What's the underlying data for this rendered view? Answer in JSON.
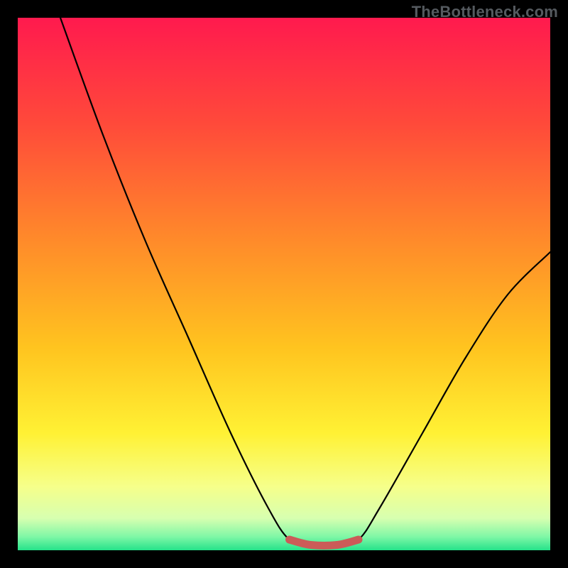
{
  "watermark": "TheBottleneck.com",
  "colors": {
    "page_bg": "#000000",
    "watermark_text": "#555a5f",
    "curve_stroke": "#000000",
    "segment_stroke": "#cb5b58",
    "gradient_stops": [
      {
        "offset": 0.0,
        "color": "#ff1a4e"
      },
      {
        "offset": 0.2,
        "color": "#ff4a3a"
      },
      {
        "offset": 0.42,
        "color": "#ff8b2a"
      },
      {
        "offset": 0.62,
        "color": "#ffc41f"
      },
      {
        "offset": 0.78,
        "color": "#fff134"
      },
      {
        "offset": 0.88,
        "color": "#f6ff8a"
      },
      {
        "offset": 0.94,
        "color": "#d7ffb0"
      },
      {
        "offset": 0.975,
        "color": "#7ef7a6"
      },
      {
        "offset": 1.0,
        "color": "#25e28a"
      }
    ]
  },
  "chart_data": {
    "type": "line",
    "title": "",
    "xlabel": "",
    "ylabel": "",
    "xlim": [
      0,
      100
    ],
    "ylim": [
      0,
      100
    ],
    "grid": false,
    "legend": false,
    "series": [
      {
        "name": "bottleneck-curve",
        "description": "Black V-shaped curve; left arm starts near top-left, drops to a flat valley, then rises to the right edge.",
        "points": [
          {
            "x": 8,
            "y": 100
          },
          {
            "x": 16,
            "y": 78
          },
          {
            "x": 24,
            "y": 58
          },
          {
            "x": 32,
            "y": 40
          },
          {
            "x": 40,
            "y": 22
          },
          {
            "x": 47,
            "y": 8
          },
          {
            "x": 51,
            "y": 2
          },
          {
            "x": 55,
            "y": 1
          },
          {
            "x": 60,
            "y": 1
          },
          {
            "x": 64,
            "y": 2
          },
          {
            "x": 68,
            "y": 8
          },
          {
            "x": 76,
            "y": 22
          },
          {
            "x": 84,
            "y": 36
          },
          {
            "x": 92,
            "y": 48
          },
          {
            "x": 100,
            "y": 56
          }
        ]
      },
      {
        "name": "valley-highlight",
        "description": "Thick red segment highlighting the flat minimum region along the curve.",
        "points": [
          {
            "x": 51,
            "y": 2
          },
          {
            "x": 55,
            "y": 1
          },
          {
            "x": 60,
            "y": 1
          },
          {
            "x": 64,
            "y": 2
          }
        ]
      }
    ]
  }
}
